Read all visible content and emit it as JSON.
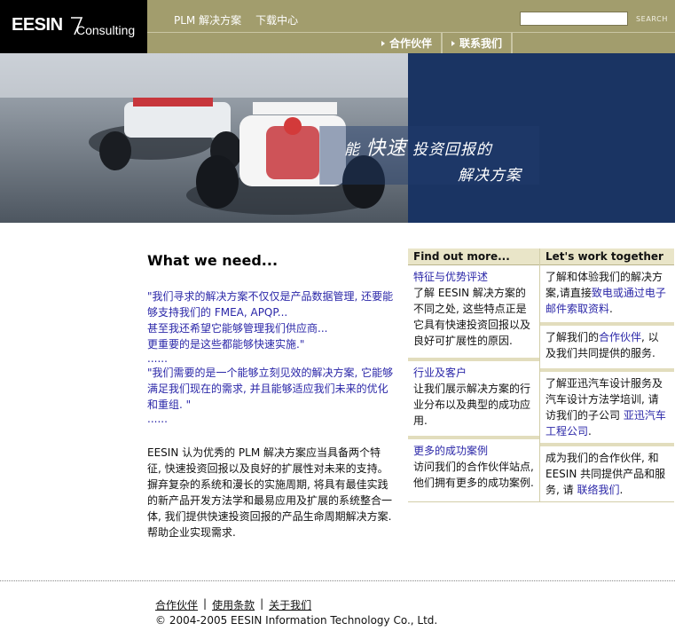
{
  "header": {
    "logo_main": "EESIN",
    "logo_sub": "Consulting",
    "nav": [
      "PLM 解决方案",
      "下载中心"
    ],
    "search_placeholder": "",
    "search_label": "SEARCH",
    "subnav": [
      "合作伙伴",
      "联系我们"
    ]
  },
  "hero": {
    "line1_a": "能",
    "line1_b": "快速",
    "line1_c": "投资回报的",
    "line2": "解决方案"
  },
  "main": {
    "title": "What we need...",
    "q1": "\"我们寻求的解决方案不仅仅是产品数据管理, 还要能够支持我们的 FMEA, APQP...",
    "q2": "甚至我还希望它能够管理我们供应商...",
    "q3": "更重要的是这些都能够快速实施.\"",
    "dots1": "......",
    "q4": "\"我们需要的是一个能够立刻见效的解决方案, 它能够满足我们现在的需求, 并且能够适应我们未来的优化和重组. \"",
    "dots2": "......",
    "p1": "EESIN 认为优秀的 PLM 解决方案应当具备两个特征, 快速投资回报以及良好的扩展性对未来的支持。",
    "p2": "摒弃复杂的系统和漫长的实施周期, 将具有最佳实践的新产品开发方法学和最易应用及扩展的系统整合一体, 我们提供快速投资回报的产品生命周期解决方案. 帮助企业实现需求."
  },
  "find": {
    "title": "Find out more...",
    "items": [
      {
        "link": "特征与优势评述",
        "text": "了解 EESIN 解决方案的不同之处, 这些特点正是它具有快速投资回报以及良好可扩展性的原因."
      },
      {
        "link": "行业及客户",
        "text": "让我们展示解决方案的行业分布以及典型的成功应用."
      },
      {
        "link": "更多的成功案例",
        "text": "访问我们的合作伙伴站点, 他们拥有更多的成功案例."
      }
    ]
  },
  "work": {
    "title": "Let's work together",
    "c1_a": "了解和体验我们的解决方案,请直接",
    "c1_link": "致电或通过电子邮件索取资料",
    "c1_b": ".",
    "c2_a": "了解我们的",
    "c2_link": "合作伙伴",
    "c2_b": ", 以及我们共同提供的服务.",
    "c3_a": "了解亚迅汽车设计服务及汽车设计方法学培训, 请访我们的子公司 ",
    "c3_link": "亚迅汽车工程公司",
    "c3_b": ".",
    "c4_a": "成为我们的合作伙伴, 和 EESIN 共同提供产品和服务, 请 ",
    "c4_link": "联络我们",
    "c4_b": "."
  },
  "footer": {
    "links": [
      "合作伙伴",
      "使用条款",
      "关于我们"
    ],
    "sep": "|",
    "copyright": "© 2004-2005 EESIN Information Technology Co., Ltd."
  },
  "colors": {
    "gold_bar": "#a29d6d",
    "navy": "#1a3463",
    "link_blue": "#2b27a8"
  }
}
